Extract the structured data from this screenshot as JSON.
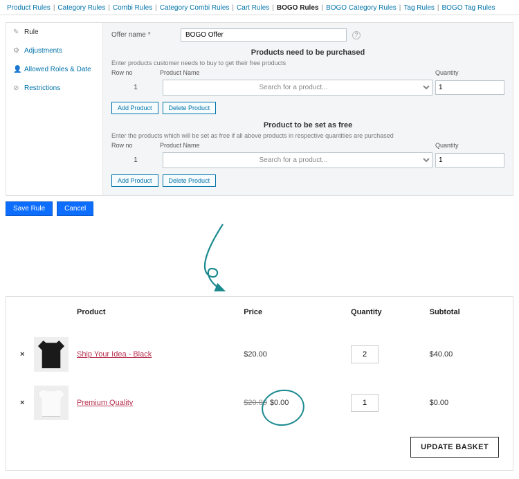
{
  "tabs": {
    "items": [
      "Product Rules",
      "Category Rules",
      "Combi Rules",
      "Category Combi Rules",
      "Cart Rules",
      "BOGO Rules",
      "BOGO Category Rules",
      "Tag Rules",
      "BOGO Tag Rules"
    ],
    "active_index": 5
  },
  "sidebar": {
    "items": [
      {
        "icon": "✎",
        "label": "Rule",
        "active": true
      },
      {
        "icon": "⚙",
        "label": "Adjustments",
        "active": false
      },
      {
        "icon": "👤",
        "label": "Allowed Roles & Date",
        "active": false
      },
      {
        "icon": "⊘",
        "label": "Restrictions",
        "active": false
      }
    ]
  },
  "offer": {
    "name_label": "Offer name *",
    "name_value": "BOGO Offer",
    "help_tip": "?"
  },
  "purchase_section": {
    "title": "Products need to be purchased",
    "hint": "Enter products customer needs to buy to get their free products",
    "headers": {
      "rowno": "Row no",
      "name": "Product Name",
      "qty": "Quantity"
    },
    "rows": [
      {
        "no": "1",
        "product_placeholder": "Search for a product...",
        "qty": "1"
      }
    ],
    "add_label": "Add Product",
    "delete_label": "Delete Product"
  },
  "free_section": {
    "title": "Product to be set as free",
    "hint": "Enter the products which will be set as free if all above products in respective quantities are purchased",
    "headers": {
      "rowno": "Row no",
      "name": "Product Name",
      "qty": "Quantity"
    },
    "rows": [
      {
        "no": "1",
        "product_placeholder": "Search for a product...",
        "qty": "1"
      }
    ],
    "add_label": "Add Product",
    "delete_label": "Delete Product"
  },
  "footer": {
    "save": "Save Rule",
    "cancel": "Cancel"
  },
  "cart": {
    "headers": {
      "product": "Product",
      "price": "Price",
      "quantity": "Quantity",
      "subtotal": "Subtotal"
    },
    "rows": [
      {
        "remove": "×",
        "thumb_color": "black",
        "name": "Ship Your Idea - Black",
        "price": "$20.00",
        "price_struck": "",
        "qty": "2",
        "subtotal": "$40.00"
      },
      {
        "remove": "×",
        "thumb_color": "white",
        "name": "Premium Quality",
        "price": "$0.00",
        "price_struck": "$20.00",
        "qty": "1",
        "subtotal": "$0.00"
      }
    ],
    "update_label": "UPDATE BASKET"
  },
  "annotation": {
    "accent": "#1b8a8f"
  }
}
